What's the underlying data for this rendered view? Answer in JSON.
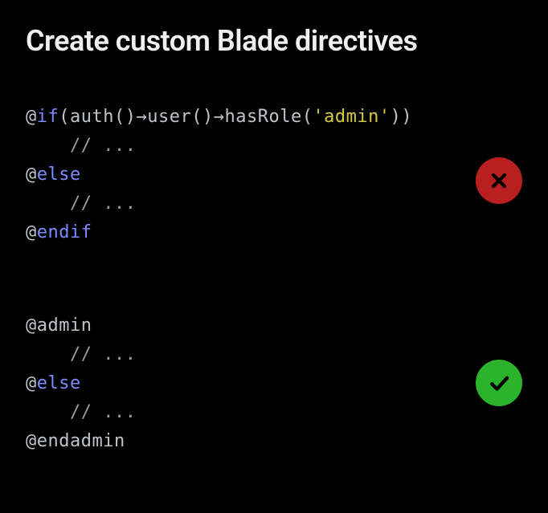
{
  "title": "Create custom Blade directives",
  "blocks": [
    {
      "status": "bad",
      "code": [
        [
          {
            "cls": "tok-at",
            "t": "@"
          },
          {
            "cls": "tok-dir",
            "t": "if"
          },
          {
            "cls": "tok-punc",
            "t": "("
          },
          {
            "cls": "tok-func",
            "t": "auth"
          },
          {
            "cls": "tok-punc",
            "t": "()"
          },
          {
            "cls": "tok-arrow",
            "t": "→"
          },
          {
            "cls": "tok-func",
            "t": "user"
          },
          {
            "cls": "tok-punc",
            "t": "()"
          },
          {
            "cls": "tok-arrow",
            "t": "→"
          },
          {
            "cls": "tok-func",
            "t": "hasRole"
          },
          {
            "cls": "tok-punc",
            "t": "("
          },
          {
            "cls": "tok-str",
            "t": "'admin'"
          },
          {
            "cls": "tok-punc",
            "t": "))"
          }
        ],
        [
          {
            "cls": "tok-cmt",
            "t": "    // ..."
          }
        ],
        [
          {
            "cls": "tok-at",
            "t": "@"
          },
          {
            "cls": "tok-dir",
            "t": "else"
          }
        ],
        [
          {
            "cls": "tok-cmt",
            "t": "    // ..."
          }
        ],
        [
          {
            "cls": "tok-at",
            "t": "@"
          },
          {
            "cls": "tok-dir",
            "t": "endif"
          }
        ]
      ]
    },
    {
      "status": "good",
      "code": [
        [
          {
            "cls": "tok-at",
            "t": "@"
          },
          {
            "cls": "tok-plain",
            "t": "admin"
          }
        ],
        [
          {
            "cls": "tok-cmt",
            "t": "    // ..."
          }
        ],
        [
          {
            "cls": "tok-at",
            "t": "@"
          },
          {
            "cls": "tok-dir",
            "t": "else"
          }
        ],
        [
          {
            "cls": "tok-cmt",
            "t": "    // ..."
          }
        ],
        [
          {
            "cls": "tok-at",
            "t": "@"
          },
          {
            "cls": "tok-plain",
            "t": "endadmin"
          }
        ]
      ]
    }
  ],
  "icons": {
    "bad": "cross-icon",
    "good": "check-icon"
  }
}
